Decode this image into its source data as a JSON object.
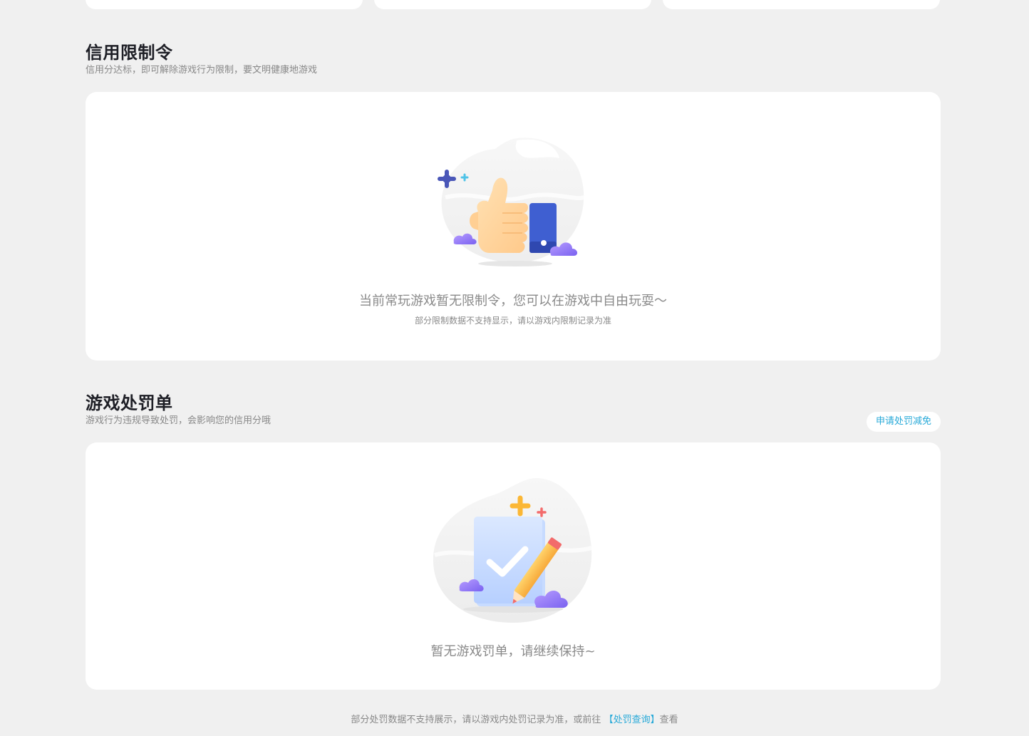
{
  "credit_restriction": {
    "title": "信用限制令",
    "subtitle": "信用分达标，即可解除游戏行为限制，要文明健康地游戏",
    "empty_text": "当前常玩游戏暂无限制令，您可以在游戏中自由玩耍～",
    "empty_note": "部分限制数据不支持显示，请以游戏内限制记录为准",
    "icon": "thumbs-up-illustration"
  },
  "penalty": {
    "title": "游戏处罚单",
    "subtitle": "游戏行为违规导致处罚，会影响您的信用分哦",
    "appeal_button": "申请处罚减免",
    "empty_text": "暂无游戏罚单，请继续保持~",
    "icon": "checklist-pencil-illustration"
  },
  "footer": {
    "prefix": "部分处罚数据不支持展示，请以游戏内处罚记录为准，或前往",
    "link": "【处罚查询】",
    "suffix": "查看"
  },
  "colors": {
    "accent": "#27a9d8",
    "background": "#f0f0f0",
    "card": "#ffffff"
  }
}
